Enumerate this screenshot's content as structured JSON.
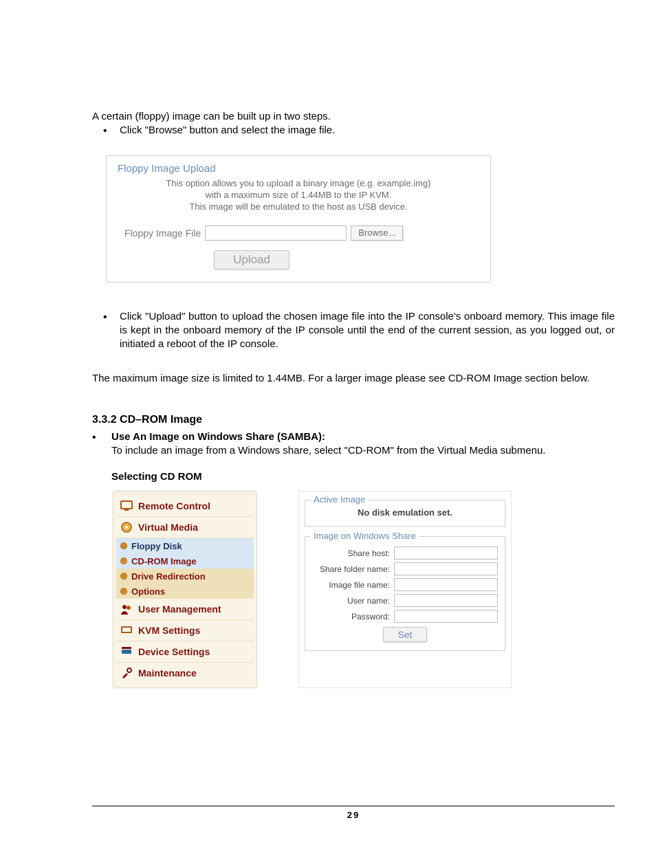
{
  "intro_line": "A certain (floppy) image can be built up in two steps.",
  "bullet1": "Click \"Browse\" button and select the image file.",
  "floppy_upload": {
    "legend": "Floppy Image Upload",
    "desc1": "This option allows you to upload a binary image (e.g. example.img)",
    "desc2": "with a maximum size of 1.44MB to the IP KVM.",
    "desc3": "This image will be emulated to the host as USB device.",
    "label": "Floppy Image File",
    "browse": "Browse...",
    "upload": "Upload"
  },
  "bullet2": "Click \"Upload\" button to upload the chosen image file into the IP console's onboard memory. This image file is kept in the onboard memory of the IP console until the end of the current session, as you logged out, or initiated a reboot of the IP console.",
  "max_para": "The maximum image size is limited to 1.44MB. For a larger image please see CD-ROM Image section below.",
  "h332": "3.3.2 CD–ROM Image",
  "samba_heading": "Use An Image on Windows Share (SAMBA):",
  "samba_body": "To include an image from a Windows share, select \"CD-ROM\" from the Virtual Media submenu.",
  "selecting_heading": "Selecting CD ROM",
  "sidebar": {
    "remote_control": "Remote Control",
    "virtual_media": "Virtual Media",
    "floppy_disk": "Floppy Disk",
    "cdrom_image": "CD-ROM Image",
    "drive_redirection": "Drive Redirection",
    "options": "Options",
    "user_management": "User Management",
    "kvm_settings": "KVM Settings",
    "device_settings": "Device Settings",
    "maintenance": "Maintenance"
  },
  "config": {
    "active_image_legend": "Active Image",
    "active_image_status": "No disk emulation set.",
    "winshare_legend": "Image on Windows Share",
    "share_host": "Share host:",
    "share_folder": "Share folder name:",
    "image_file": "Image file name:",
    "user_name": "User name:",
    "password": "Password:",
    "set": "Set"
  },
  "page_number": "29"
}
